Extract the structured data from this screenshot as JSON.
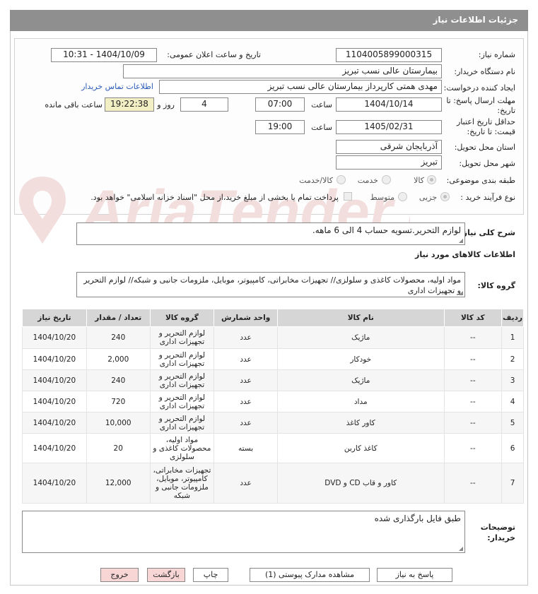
{
  "header": {
    "title": "جزئیات اطلاعات نیاز"
  },
  "form": {
    "need_number_label": "شماره نیاز:",
    "need_number": "1104005899000315",
    "announce_label": "تاریخ و ساعت اعلان عمومی:",
    "announce_value": "1404/10/09 - 10:31",
    "buyer_org_label": "نام دستگاه خریدار:",
    "buyer_org": "بیمارستان عالی نسب تبریز",
    "creator_label": "ایجاد کننده درخواست:",
    "creator": "مهدی همتی کارپرداز بیمارستان عالی نسب تبریز",
    "contact_link": "اطلاعات تماس خریدار",
    "deadline_label_1": "مهلت ارسال پاسخ: تا",
    "deadline_label_2": "تاریخ:",
    "deadline_date": "1404/10/14",
    "time_label": "ساعت",
    "deadline_time": "07:00",
    "days": "4",
    "days_label": "روز و",
    "remaining_time": "19:22:38",
    "remaining_label": "ساعت باقی مانده",
    "validity_label_1": "حداقل تاریخ اعتبار",
    "validity_label_2": "قیمت: تا تاریخ:",
    "validity_date": "1405/02/31",
    "validity_time": "19:00",
    "province_label": "استان محل تحویل:",
    "province": "آذربایجان شرقی",
    "city_label": "شهر محل تحویل:",
    "city": "تبریز",
    "category_label": "طبقه بندی موضوعی:",
    "category_options": [
      "کالا",
      "خدمت",
      "کالا/خدمت"
    ],
    "process_label": "نوع فرآیند خرید :",
    "process_options": [
      "جزیی",
      "متوسط"
    ],
    "treasury_note": "پرداخت تمام یا بخشی از مبلغ خرید،از محل \"اسناد خزانه اسلامی\" خواهد بود.",
    "description_label": "شرح کلی نیاز:",
    "description": "لوازم التحریر.تسویه حساب 4 الی 6 ماهه.",
    "goods_info_title": "اطلاعات کالاهای مورد نیاز",
    "goods_group_label": "گروه کالا:",
    "goods_group": "مواد اولیه، محصولات کاغذی و سلولزی// تجهیزات مخابراتی، کامپیوتر، موبایل، ملزومات جانبی و شبکه// لوازم التحریر و تجهیزات اداری"
  },
  "table": {
    "headers": [
      "ردیف",
      "کد کالا",
      "نام کالا",
      "واحد شمارش",
      "گروه کالا",
      "تعداد / مقدار",
      "تاریخ نیاز"
    ],
    "rows": [
      [
        "1",
        "--",
        "ماژیک",
        "عدد",
        "لوازم التحریر و تجهیزات اداری",
        "240",
        "1404/10/20"
      ],
      [
        "2",
        "--",
        "خودکار",
        "عدد",
        "لوازم التحریر و تجهیزات اداری",
        "2,000",
        "1404/10/20"
      ],
      [
        "3",
        "--",
        "ماژیک",
        "عدد",
        "لوازم التحریر و تجهیزات اداری",
        "240",
        "1404/10/20"
      ],
      [
        "4",
        "--",
        "مداد",
        "عدد",
        "لوازم التحریر و تجهیزات اداری",
        "720",
        "1404/10/20"
      ],
      [
        "5",
        "--",
        "کاور کاغذ",
        "عدد",
        "لوازم التحریر و تجهیزات اداری",
        "10,000",
        "1404/10/20"
      ],
      [
        "6",
        "--",
        "کاغذ کاربن",
        "بسته",
        "مواد اولیه، محصولات کاغذی و سلولزی",
        "20",
        "1404/10/20"
      ],
      [
        "7",
        "--",
        "کاور و قاب CD و DVD",
        "عدد",
        "تجهیزات مخابراتی، کامپیوتر، موبایل، ملزومات جانبی و شبکه",
        "12,000",
        "1404/10/20"
      ]
    ]
  },
  "buyer_notes_label_1": "توضیحات",
  "buyer_notes_label_2": "خریدار:",
  "buyer_notes": "طبق فایل بارگذاری شده",
  "buttons": {
    "reply": "پاسخ به نیاز",
    "attachments": "مشاهده مدارک پیوستی (1)",
    "print": "چاپ",
    "back": "بازگشت",
    "exit": "خروج"
  },
  "watermark_text": "AriaTender.net",
  "colors": {
    "titlebar": "#8f8f8f",
    "watermark": "#f3dede",
    "link": "#2a5ab8"
  }
}
